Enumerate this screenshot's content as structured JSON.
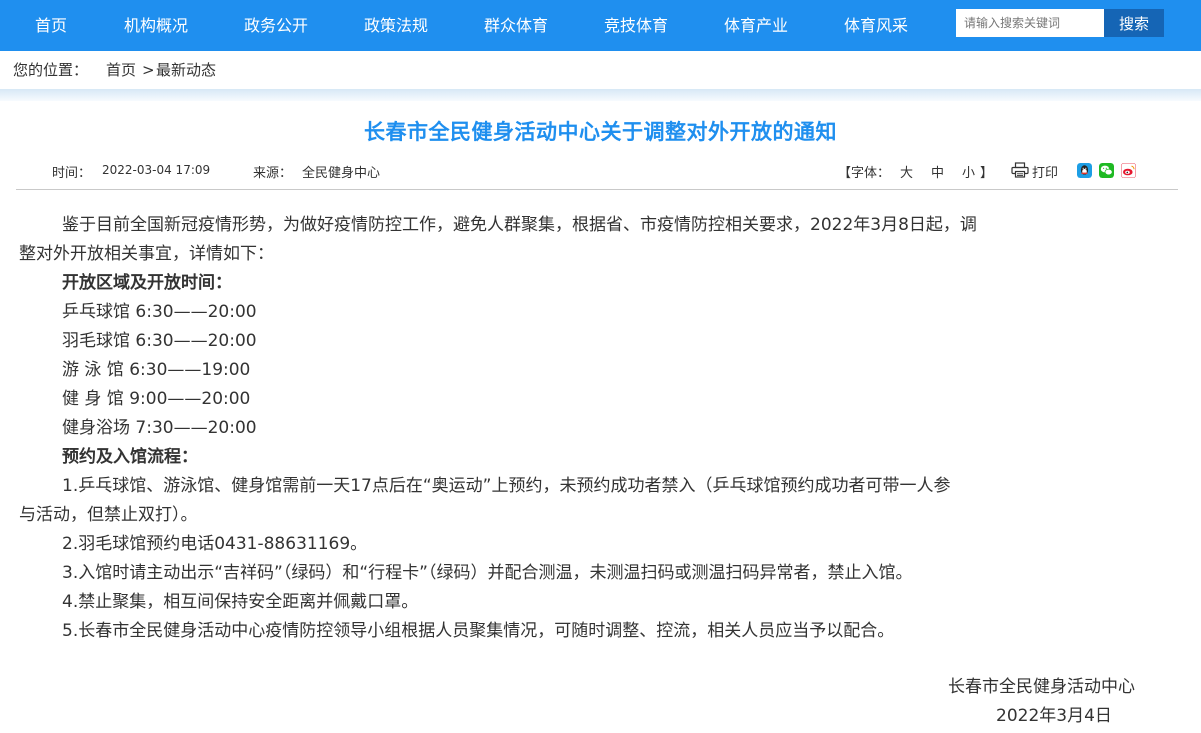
{
  "nav": {
    "items": [
      "首页",
      "机构概况",
      "政务公开",
      "政策法规",
      "群众体育",
      "竞技体育",
      "体育产业",
      "体育风采"
    ],
    "search_placeholder": "请输入搜索关键词",
    "search_label": "搜索"
  },
  "breadcrumb": {
    "prefix": "您的位置：",
    "home": "首页",
    "sep": ">",
    "current": "最新动态"
  },
  "article": {
    "title": "长春市全民健身活动中心关于调整对外开放的通知",
    "time_label": "时间：",
    "time": "2022-03-04 17:09",
    "source_label": "来源：",
    "source": "全民健身中心",
    "font_prefix": "【字体：",
    "font_large": "大",
    "font_medium": "中",
    "font_small": "小",
    "font_suffix": "】",
    "print": "打印",
    "intro_line1": "鉴于目前全国新冠疫情形势，为做好疫情防控工作，避免人群聚集，根据省、市疫情防控相关要求，2022年3月8日起，调",
    "intro_line2": "整对外开放相关事宜，详情如下：",
    "section1": "开放区域及开放时间：",
    "hours": [
      "乒乓球馆 6:30——20:00",
      "羽毛球馆 6:30——20:00",
      "游 泳 馆 6:30——19:00",
      "健 身 馆 9:00——20:00",
      "健身浴场 7:30——20:00"
    ],
    "section2": "预约及入馆流程：",
    "rule1_line1": "1.乒乓球馆、游泳馆、健身馆需前一天17点后在“奥运动”上预约，未预约成功者禁入（乒乓球馆预约成功者可带一人参",
    "rule1_line2": "与活动，但禁止双打）。",
    "rule2": "2.羽毛球馆预约电话0431-88631169。",
    "rule3": "3.入馆时请主动出示“吉祥码”（绿码）和“行程卡”（绿码）并配合测温，未测温扫码或测温扫码异常者，禁止入馆。",
    "rule4": "4.禁止聚集，相互间保持安全距离并佩戴口罩。",
    "rule5": "5.长春市全民健身活动中心疫情防控领导小组根据人员聚集情况，可随时调整、控流，相关人员应当予以配合。",
    "signature": "长春市全民健身活动中心",
    "date": "2022年3月4日"
  },
  "colors": {
    "nav_bg": "#1f8fef",
    "title": "#1f8fef",
    "search_button": "#1565b5"
  },
  "icons": {
    "print": "printer-icon",
    "share": [
      "qq-share-icon",
      "wechat-share-icon",
      "weibo-share-icon"
    ]
  }
}
